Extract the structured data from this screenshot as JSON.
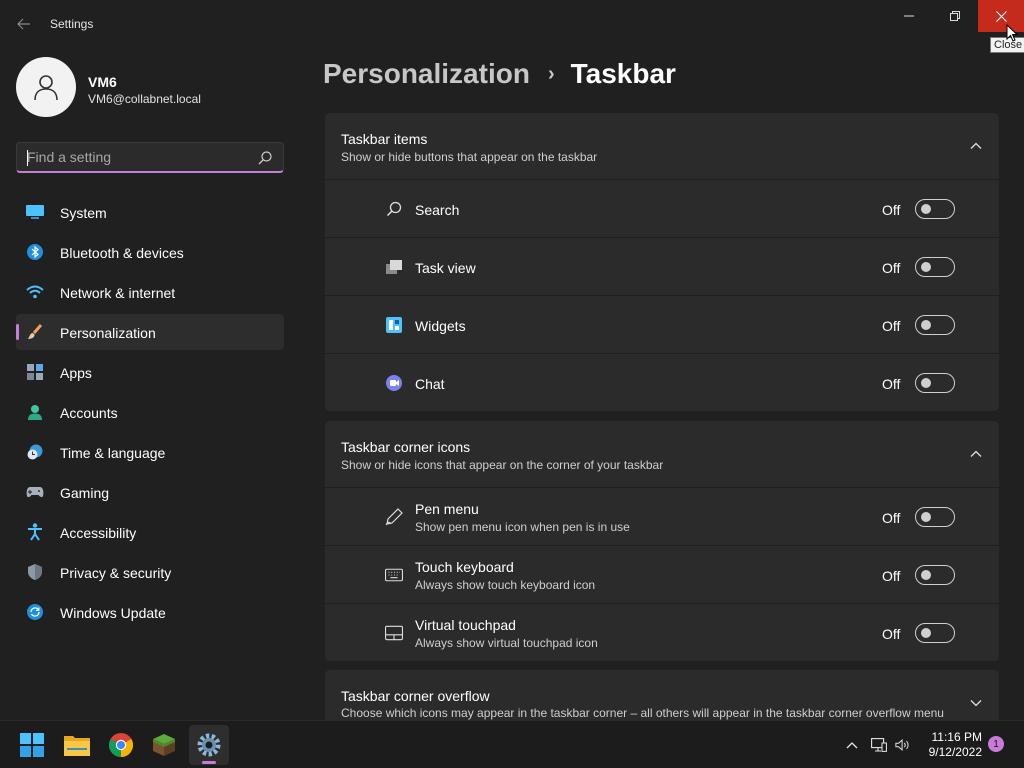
{
  "window": {
    "title": "Settings",
    "close_tooltip": "Close",
    "icons": {
      "back": "back-arrow-icon",
      "minimize": "minimize-icon",
      "maximize": "restore-icon",
      "close": "close-icon"
    }
  },
  "profile": {
    "name": "VM6",
    "email": "VM6@collabnet.local"
  },
  "search": {
    "placeholder": "Find a setting",
    "value": ""
  },
  "sidebar": {
    "accent_color": "#c77dd7",
    "items": [
      {
        "label": "System",
        "icon": "system-display-icon",
        "active": false
      },
      {
        "label": "Bluetooth & devices",
        "icon": "bluetooth-icon",
        "active": false
      },
      {
        "label": "Network & internet",
        "icon": "wifi-icon",
        "active": false
      },
      {
        "label": "Personalization",
        "icon": "paintbrush-icon",
        "active": true
      },
      {
        "label": "Apps",
        "icon": "apps-icon",
        "active": false
      },
      {
        "label": "Accounts",
        "icon": "person-icon",
        "active": false
      },
      {
        "label": "Time & language",
        "icon": "clock-globe-icon",
        "active": false
      },
      {
        "label": "Gaming",
        "icon": "gamepad-icon",
        "active": false
      },
      {
        "label": "Accessibility",
        "icon": "accessibility-icon",
        "active": false
      },
      {
        "label": "Privacy & security",
        "icon": "shield-icon",
        "active": false
      },
      {
        "label": "Windows Update",
        "icon": "update-icon",
        "active": false
      }
    ]
  },
  "breadcrumb": {
    "parent": "Personalization",
    "separator": "›",
    "current": "Taskbar"
  },
  "sections": [
    {
      "title": "Taskbar items",
      "subtitle": "Show or hide buttons that appear on the taskbar",
      "expanded": true,
      "rows": [
        {
          "label": "Search",
          "description": "",
          "state": "Off",
          "icon": "search-icon"
        },
        {
          "label": "Task view",
          "description": "",
          "state": "Off",
          "icon": "task-view-icon"
        },
        {
          "label": "Widgets",
          "description": "",
          "state": "Off",
          "icon": "widgets-icon"
        },
        {
          "label": "Chat",
          "description": "",
          "state": "Off",
          "icon": "chat-icon"
        }
      ]
    },
    {
      "title": "Taskbar corner icons",
      "subtitle": "Show or hide icons that appear on the corner of your taskbar",
      "expanded": true,
      "rows": [
        {
          "label": "Pen menu",
          "description": "Show pen menu icon when pen is in use",
          "state": "Off",
          "icon": "pen-icon"
        },
        {
          "label": "Touch keyboard",
          "description": "Always show touch keyboard icon",
          "state": "Off",
          "icon": "keyboard-icon"
        },
        {
          "label": "Virtual touchpad",
          "description": "Always show virtual touchpad icon",
          "state": "Off",
          "icon": "touchpad-icon"
        }
      ]
    },
    {
      "title": "Taskbar corner overflow",
      "subtitle": "Choose which icons may appear in the taskbar corner – all others will appear in the taskbar corner overflow menu",
      "expanded": false,
      "rows": []
    }
  ],
  "taskbar": {
    "apps": [
      {
        "name": "start-button",
        "icon": "windows-logo-icon"
      },
      {
        "name": "file-explorer",
        "icon": "folder-icon"
      },
      {
        "name": "chrome",
        "icon": "chrome-icon"
      },
      {
        "name": "minecraft",
        "icon": "minecraft-block-icon"
      },
      {
        "name": "settings",
        "icon": "gear-icon",
        "active": true
      }
    ],
    "time": "11:16 PM",
    "date": "9/12/2022",
    "notification_count": "1"
  }
}
